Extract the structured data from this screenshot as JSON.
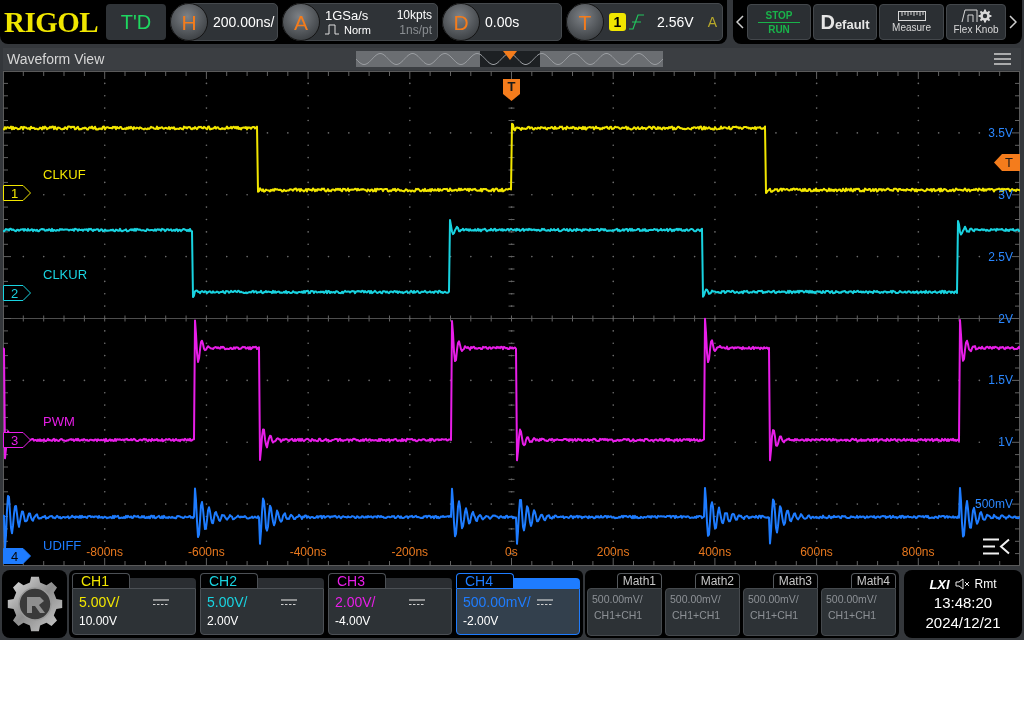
{
  "top_bar": {
    "logo": "RIGOL",
    "mode": "T'D",
    "horizontal": {
      "key": "H",
      "scale": "200.00ns/"
    },
    "acquire": {
      "key": "A",
      "sample_rate": "1GSa/s",
      "mode": "Norm",
      "memory_depth": "10kpts",
      "resolution": "1ns/pt"
    },
    "delay": {
      "key": "D",
      "value": "0.00s"
    },
    "trigger": {
      "key": "T",
      "source": "1",
      "level": "2.56V",
      "sweep": "A"
    },
    "buttons": [
      {
        "kind": "run_stop",
        "labels": [
          "STOP",
          "RUN"
        ]
      },
      {
        "kind": "default",
        "label": "Default"
      },
      {
        "kind": "measure",
        "label": "Measure"
      },
      {
        "kind": "flex_knob",
        "label": "Flex Knob"
      }
    ]
  },
  "waveform_view": {
    "title": "Waveform View",
    "trigger_position_marker": "T",
    "trigger_level_marker": "T",
    "traces": [
      {
        "label": "CLKUF",
        "marker": "1",
        "color": "#f2e600",
        "selected": false
      },
      {
        "label": "CLKUR",
        "marker": "2",
        "color": "#19d3e0",
        "selected": false
      },
      {
        "label": "PWM",
        "marker": "3",
        "color": "#e81ee8",
        "selected": false
      },
      {
        "label": "UDIFF",
        "marker": "4",
        "color": "#1e7cff",
        "selected": true
      }
    ],
    "y_axis_labels": [
      "3.5V",
      "3V",
      "2.5V",
      "2V",
      "1.5V",
      "1V",
      "500mV"
    ],
    "x_axis_labels": [
      "-800ns",
      "-600ns",
      "-400ns",
      "-200ns",
      "0s",
      "200ns",
      "400ns",
      "600ns",
      "800ns"
    ]
  },
  "bottom_bar": {
    "channels": [
      {
        "name": "CH1",
        "scale": "5.00V/",
        "offset": "10.00V",
        "color": "#f2e600",
        "selected": false
      },
      {
        "name": "CH2",
        "scale": "5.00V/",
        "offset": "2.00V",
        "color": "#19d3e0",
        "selected": false
      },
      {
        "name": "CH3",
        "scale": "2.00V/",
        "offset": "-4.00V",
        "color": "#e81ee8",
        "selected": false
      },
      {
        "name": "CH4",
        "scale": "500.00mV/",
        "offset": "-2.00V",
        "color": "#1e7cff",
        "selected": true
      }
    ],
    "math_channels": [
      {
        "name": "Math1",
        "scale": "500.00mV/",
        "source": "CH1+CH1"
      },
      {
        "name": "Math2",
        "scale": "500.00mV/",
        "source": "CH1+CH1"
      },
      {
        "name": "Math3",
        "scale": "500.00mV/",
        "source": "CH1+CH1"
      },
      {
        "name": "Math4",
        "scale": "500.00mV/",
        "source": "CH1+CH1"
      }
    ],
    "status": {
      "interface": "LXI",
      "remote": "Rmt",
      "time": "13:48:20",
      "date": "2024/12/21"
    }
  }
}
